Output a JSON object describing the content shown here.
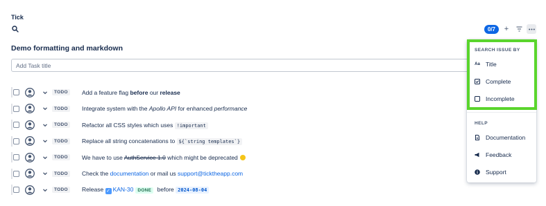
{
  "app": {
    "title": "Tick"
  },
  "toolbar": {
    "count": "0/7",
    "add_icon": "plus-icon",
    "filter_icon": "filter-icon",
    "more_icon": "more-icon"
  },
  "list": {
    "title": "Demo formatting and markdown",
    "add_placeholder": "Add Task title"
  },
  "tasks": [
    {
      "status": "TODO",
      "parts": [
        "Add a feature flag ",
        "before",
        " our ",
        "release"
      ]
    },
    {
      "status": "TODO",
      "parts": [
        "Integrate system with the ",
        "Apollo API",
        " for enhanced ",
        "performance"
      ]
    },
    {
      "status": "TODO",
      "parts": [
        "Refactor all CSS styles which uses ",
        "!important"
      ]
    },
    {
      "status": "TODO",
      "parts": [
        "Replace all string concatenations to ",
        "${`string templates`}"
      ]
    },
    {
      "status": "TODO",
      "parts": [
        "We have to use ",
        "AuthService 1.0",
        " which might be deprecated"
      ]
    },
    {
      "status": "TODO",
      "parts": [
        "Check the ",
        "documentation",
        " or mail us ",
        "support@ticktheapp.com"
      ]
    },
    {
      "status": "TODO",
      "parts": [
        "Release ",
        "KAN-30",
        "DONE",
        " before ",
        "2024-08-04"
      ]
    }
  ],
  "menu": {
    "search_header": "SEARCH ISSUE BY",
    "search_items": [
      {
        "label": "Title",
        "icon": "text-icon",
        "glyph": "Aa"
      },
      {
        "label": "Complete",
        "icon": "checked-box-icon"
      },
      {
        "label": "Incomplete",
        "icon": "empty-box-icon"
      }
    ],
    "help_header": "HELP",
    "help_items": [
      {
        "label": "Documentation",
        "icon": "document-icon"
      },
      {
        "label": "Feedback",
        "icon": "megaphone-icon"
      },
      {
        "label": "Support",
        "icon": "info-icon"
      }
    ]
  },
  "colors": {
    "accent": "#0c66e4",
    "highlight": "#5ad52c",
    "done": "#216e4e"
  }
}
